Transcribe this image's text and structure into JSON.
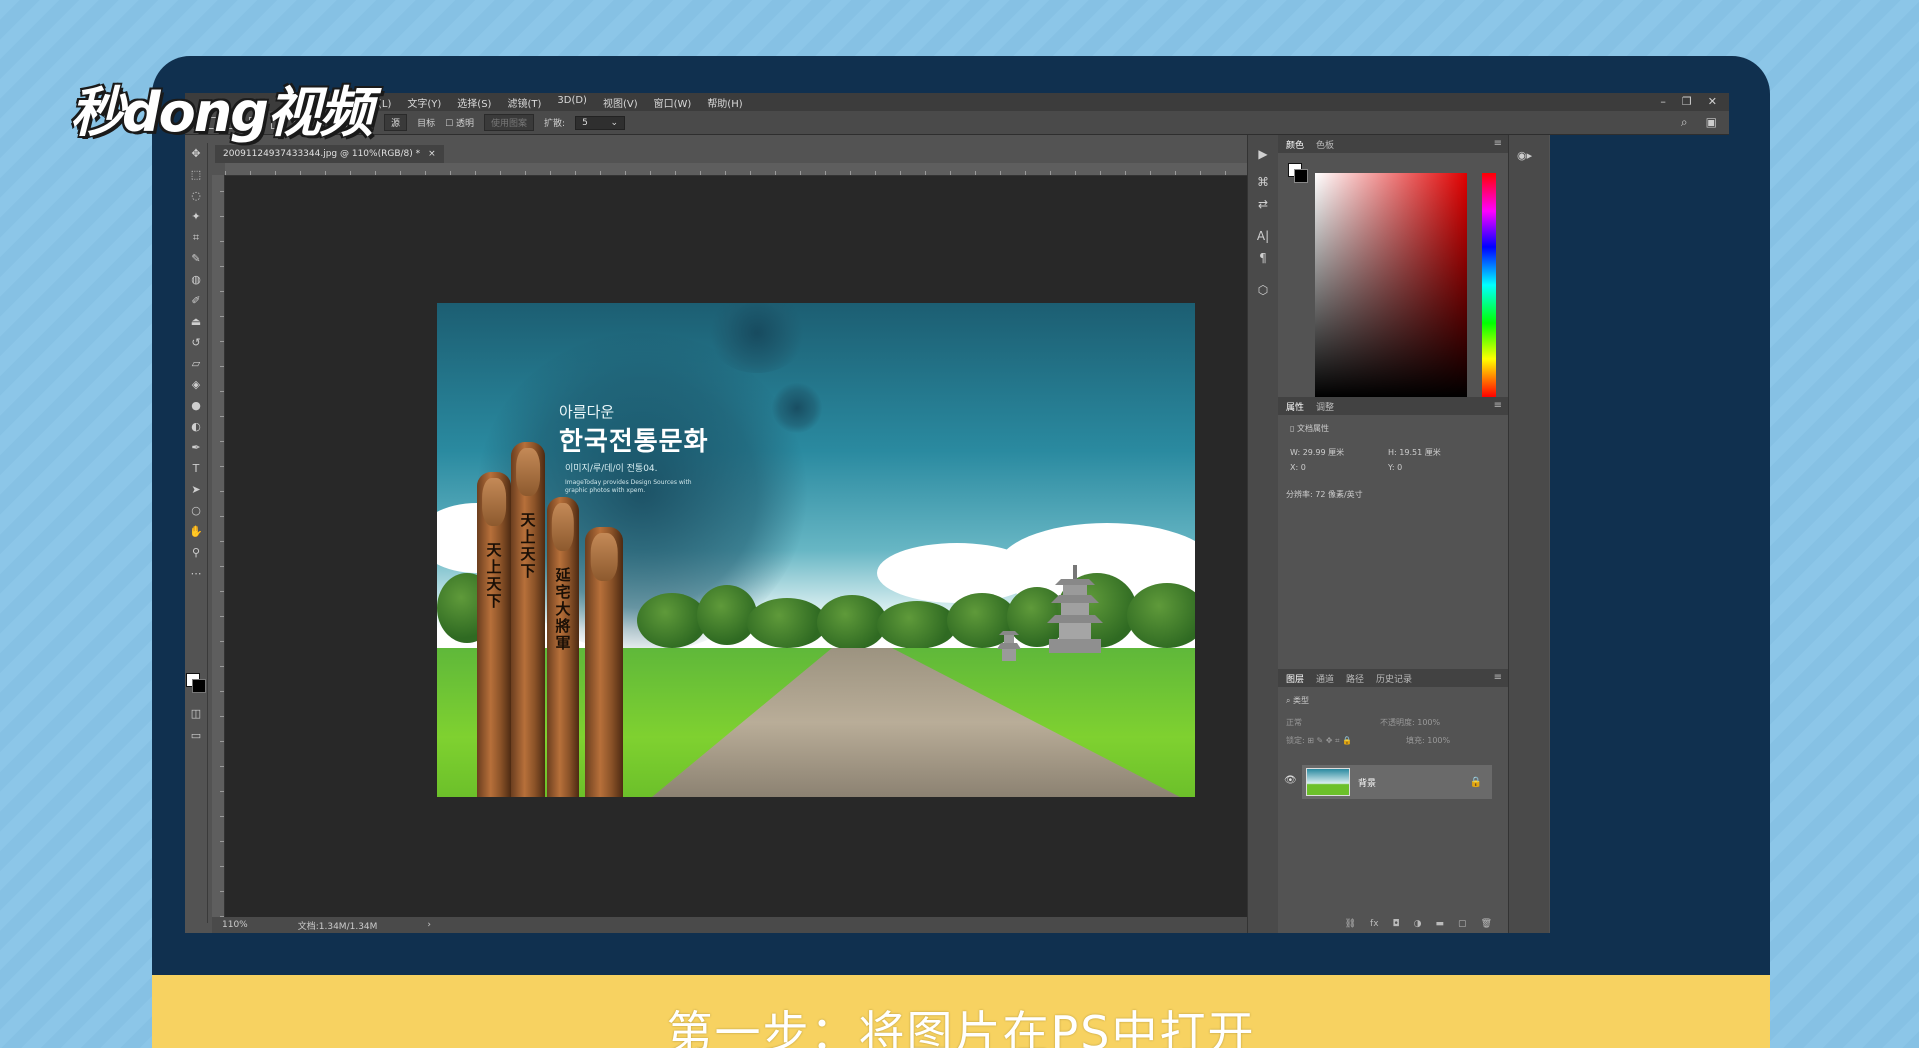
{
  "watermark": {
    "logo_text": "秒dong视频"
  },
  "photoshop": {
    "menu": [
      "图层(L)",
      "文字(Y)",
      "选择(S)",
      "滤镜(T)",
      "3D(D)",
      "视图(V)",
      "窗口(W)",
      "帮助(H)"
    ],
    "options": {
      "feather_label": "羽化:",
      "style_label": "正常",
      "btn_new": "源",
      "btn_target": "目标",
      "transparent_label": "透明",
      "use_pattern": "使用图案",
      "diffusion_label": "扩散:",
      "diffusion_value": "5"
    },
    "document_tab": "20091124937433344.jpg @ 110%(RGB/8) *",
    "status": {
      "zoom": "110%",
      "doc_size": "文档:1.34M/1.34M"
    },
    "color_panel": {
      "tab_color": "颜色",
      "tab_swatches": "色板"
    },
    "properties_panel": {
      "tab_properties": "属性",
      "tab_adjust": "调整",
      "doc_props_label": "文档属性",
      "w_label": "W:",
      "w_value": "29.99 厘米",
      "h_label": "H:",
      "h_value": "19.51 厘米",
      "x_label": "X:",
      "x_value": "0",
      "y_label": "Y:",
      "y_value": "0",
      "resolution": "分辨率: 72 像素/英寸"
    },
    "layers_panel": {
      "tabs": [
        "图层",
        "通道",
        "路径",
        "历史记录"
      ],
      "filter_label": "类型",
      "blend_mode": "正常",
      "opacity_label": "不透明度:",
      "opacity_value": "100%",
      "lock_label": "锁定:",
      "fill_label": "填充:",
      "fill_value": "100%",
      "layer_name": "背景"
    }
  },
  "artwork": {
    "korean_small": "아름다운",
    "korean_big": "한국전통문화",
    "korean_sub": "이미지/루/데/이 전통04.",
    "korean_desc": "ImageToday provides Design Sources with graphic photos with xpem.",
    "pole_texts": [
      "天上天下",
      "天上天下",
      "延宅大將軍"
    ]
  },
  "caption": "第一步：将图片在PS中打开"
}
